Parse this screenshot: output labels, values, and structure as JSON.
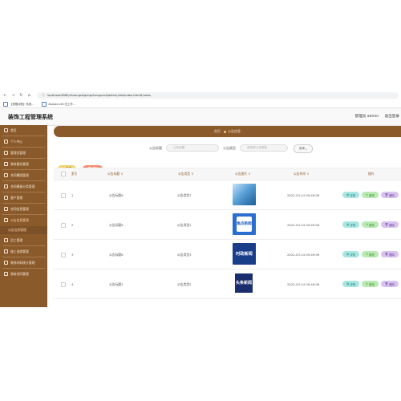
{
  "browser": {
    "url": "localhost:8080/zhuangshigongchenguanli/admin/dist/index.html#/news",
    "bookmarks": [
      "【资格对账】系统...",
      "Aspose.cell 无工作..."
    ]
  },
  "header": {
    "app_title": "装饰工程管理系统",
    "user_label": "管理员 admin",
    "logout": "退出登录"
  },
  "sidebar": {
    "items": [
      {
        "label": "首页"
      },
      {
        "label": "个人中心"
      },
      {
        "label": "管理员管理"
      },
      {
        "label": "装修服务管理"
      },
      {
        "label": "合同模版管理"
      },
      {
        "label": "合同模板分类管理"
      },
      {
        "label": "客户管理"
      },
      {
        "label": "合同信息管理"
      },
      {
        "label": "公告信息管理"
      },
      {
        "label": "公告信息管理",
        "sub": true
      },
      {
        "label": "员工管理"
      },
      {
        "label": "施工进度管理"
      },
      {
        "label": "装修材料统计管理"
      },
      {
        "label": "装修合同管理"
      }
    ]
  },
  "banner": {
    "home": "首页",
    "current": "公告信息"
  },
  "search": {
    "title_label": "公告标题",
    "title_placeholder": "公告标题",
    "type_label": "公告类型",
    "type_placeholder": "请选择公告类型",
    "button": "查询"
  },
  "actions": {
    "add": "+ 新增",
    "delete": "删除"
  },
  "table": {
    "headers": [
      "索引",
      "公告标题",
      "公告类型",
      "公告图片",
      "公告时间",
      "操作"
    ],
    "rows": [
      {
        "index": "1",
        "title": "公告标题8",
        "type": "公告类型7",
        "time": "2022-03-14 09:49:09"
      },
      {
        "index": "2",
        "title": "公告标题6",
        "type": "公告类型2",
        "time": "2022-03-14 09:49:09"
      },
      {
        "index": "3",
        "title": "公告标题8",
        "type": "公告类型3",
        "time": "2022-03-14 09:49:09"
      },
      {
        "index": "4",
        "title": "公告标题2",
        "type": "公告类型2",
        "time": "2022-03-14 09:49:09"
      }
    ],
    "thumb_text": [
      "",
      "焦点新闻",
      "时政新闻",
      "头条新闻"
    ],
    "ops": {
      "detail": "详情",
      "edit": "修改",
      "delete": "删除"
    }
  }
}
